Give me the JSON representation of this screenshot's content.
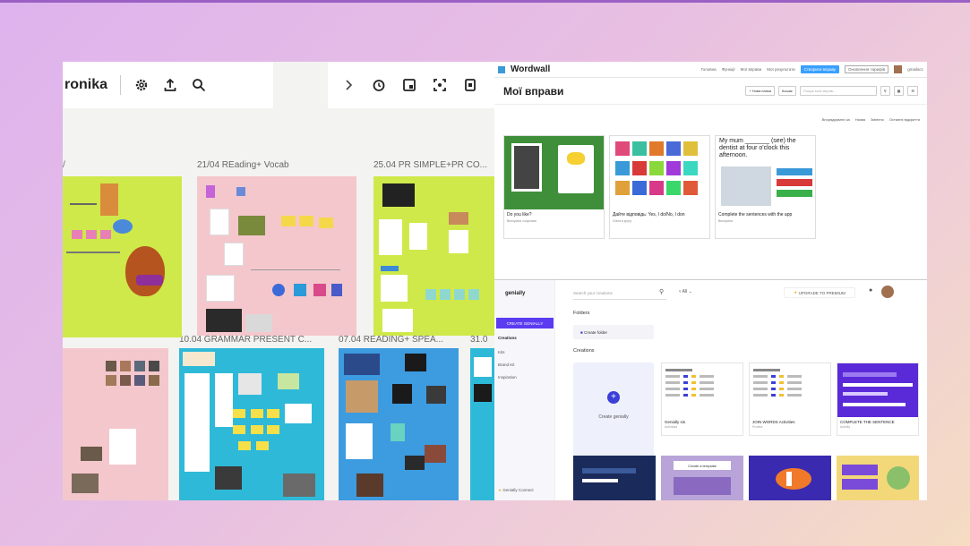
{
  "padlet": {
    "title": "ronika",
    "sections": [
      "21/04 REading+ Vocab",
      "25.04 PR SIMPLE+PR CO...",
      "10.04 GRAMMAR PRESENT C...",
      "07.04 READING+ SPEA...",
      "31.0"
    ],
    "toolbar_icons": [
      "gear-icon",
      "share-icon",
      "search-icon",
      "chevron-right-icon",
      "timer-icon",
      "slideshow-icon",
      "focus-icon",
      "panel-icon"
    ],
    "colors": {
      "lime": "#cfe94a",
      "pink": "#f4c7cd",
      "cyan": "#2fb9d8",
      "blue": "#3d9be0"
    }
  },
  "wordwall": {
    "logo": "Wordwall",
    "nav": [
      "Головна",
      "Функції",
      "Мої вправи",
      "Мої результати"
    ],
    "cta": "Створити вправу",
    "plan": "Оновлення тарифів",
    "user": "gmailacc",
    "page_title": "Мої вправи",
    "tools": [
      "+ Нова папка",
      "Кошик",
      "Пошук моїх вправ..."
    ],
    "sort": [
      "Впорядкувати за",
      "Назва",
      "Змінено",
      "Останнє відкриття"
    ],
    "cards": [
      {
        "title": "Do you like?",
        "meta": "Вікторина з картами"
      },
      {
        "title": "Дайте відповідь: Yes, I do/No, I don",
        "meta": "Спіна в кругу"
      },
      {
        "title": "Complete the sentences with the app",
        "meta": "Вікторина"
      }
    ],
    "card3_text": "My mum _______ (see) the dentist at four o'clock this afternoon."
  },
  "genially": {
    "logo": "genially",
    "create": "CREATE GENIALLY",
    "nav": [
      "Creations",
      "Kits",
      "Brand Kit",
      "Inspiration"
    ],
    "footer": "Genially Connect",
    "search": "Search your creations",
    "filter": "All",
    "upgrade": "UPGRADE TO PREMIUM",
    "folders_label": "Folders",
    "folder_item": "Create folder",
    "creations_label": "Creations",
    "new_label": "Create genially",
    "cards": [
      {
        "title": "Genially sin",
        "meta": "Actividad"
      },
      {
        "title": "JOIN WORDS Activities",
        "meta": "Prueba"
      },
      {
        "title": "COMPLETE THE SENTENCE",
        "meta": "Activity"
      }
    ],
    "bottom_card": "Create a template"
  }
}
